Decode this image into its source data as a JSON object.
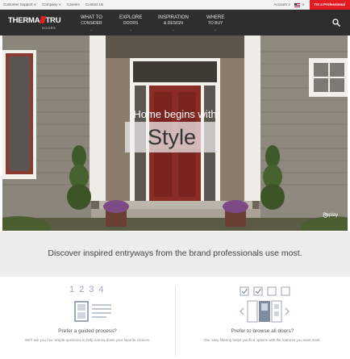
{
  "utility_bar": {
    "links": [
      "Customer Support ∨",
      "Company ∨",
      "Careers",
      "Contact Us"
    ],
    "account": "Account ∨",
    "language_caret": "∨",
    "pro_button": "I'm a Professional"
  },
  "nav": {
    "brand": {
      "left": "THERMA",
      "right": "TRU",
      "sub": "DOORS"
    },
    "items": [
      {
        "line1": "WHAT TO",
        "line2": "CONSIDER"
      },
      {
        "line1": "EXPLORE",
        "line2": "DOORS"
      },
      {
        "line1": "INSPIRATION",
        "line2": "& DESIGN"
      },
      {
        "line1": "WHERE",
        "line2": "TO BUY"
      }
    ],
    "chevron": "⌄",
    "search_icon": "search-icon"
  },
  "hero": {
    "headline": "Home begins with",
    "emphasis": "Style",
    "replay_label": "Replay",
    "colors": {
      "door": "#8a2b26",
      "siding": "#7a7469",
      "trim": "#f2f0ea"
    }
  },
  "discover": {
    "text": "Discover inspired entryways from the brand professionals use most."
  },
  "options": {
    "guided": {
      "steps": [
        "1",
        "2",
        "3",
        "4"
      ],
      "title": "Prefer a guided process?",
      "description": "We'll ask you four simple questions to help narrow down your favorite choices."
    },
    "browse": {
      "title": "Prefer to browse all doors?",
      "description": "Our easy filtering helps you find options with the features you want most."
    }
  },
  "colors": {
    "accent": "#e31b23",
    "nav_bg": "#2e2e2e",
    "band_bg": "#ececec"
  }
}
